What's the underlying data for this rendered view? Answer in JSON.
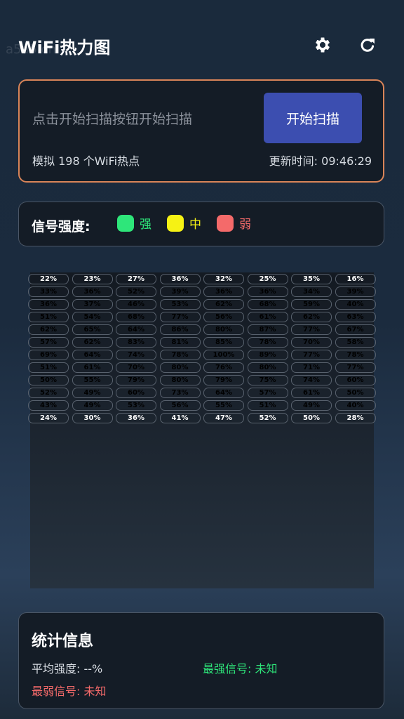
{
  "watermark": "a5a5.cn",
  "header": {
    "title": "WiFi热力图",
    "settings_icon": "gear-icon",
    "refresh_icon": "refresh-icon"
  },
  "scan": {
    "placeholder": "点击开始扫描按钮开始扫描",
    "button_label": "开始扫描",
    "sim_text": "模拟 198 个WiFi热点",
    "time_text": "更新时间: 09:46:29",
    "border_color": "#d98458",
    "button_color": "#3c4eb0"
  },
  "legend": {
    "label": "信号强度:",
    "items": [
      {
        "label": "强",
        "color": "#2ee67a"
      },
      {
        "label": "中",
        "color": "#f6f214"
      },
      {
        "label": "弱",
        "color": "#f46a6a"
      }
    ]
  },
  "heatmap": {
    "rows": [
      [
        "22%",
        "23%",
        "27%",
        "36%",
        "32%",
        "25%",
        "35%",
        "16%"
      ],
      [
        "33%",
        "36%",
        "52%",
        "39%",
        "36%",
        "36%",
        "34%",
        "39%"
      ],
      [
        "36%",
        "37%",
        "46%",
        "53%",
        "62%",
        "68%",
        "59%",
        "40%"
      ],
      [
        "51%",
        "54%",
        "68%",
        "77%",
        "56%",
        "61%",
        "62%",
        "63%"
      ],
      [
        "62%",
        "65%",
        "64%",
        "86%",
        "80%",
        "87%",
        "77%",
        "67%"
      ],
      [
        "57%",
        "62%",
        "83%",
        "81%",
        "85%",
        "78%",
        "70%",
        "58%"
      ],
      [
        "69%",
        "64%",
        "74%",
        "78%",
        "100%",
        "89%",
        "77%",
        "78%"
      ],
      [
        "51%",
        "61%",
        "70%",
        "80%",
        "76%",
        "80%",
        "71%",
        "77%"
      ],
      [
        "50%",
        "55%",
        "79%",
        "80%",
        "79%",
        "75%",
        "74%",
        "60%"
      ],
      [
        "52%",
        "49%",
        "60%",
        "73%",
        "64%",
        "57%",
        "61%",
        "50%"
      ],
      [
        "43%",
        "49%",
        "53%",
        "56%",
        "55%",
        "51%",
        "49%",
        "40%"
      ],
      [
        "24%",
        "30%",
        "36%",
        "41%",
        "47%",
        "52%",
        "50%",
        "28%"
      ]
    ]
  },
  "stats": {
    "title": "统计信息",
    "avg": "平均强度: --%",
    "strongest": "最强信号: 未知",
    "weakest": "最弱信号: 未知",
    "strongest_color": "#2ee67a",
    "weakest_color": "#f46a6a"
  }
}
